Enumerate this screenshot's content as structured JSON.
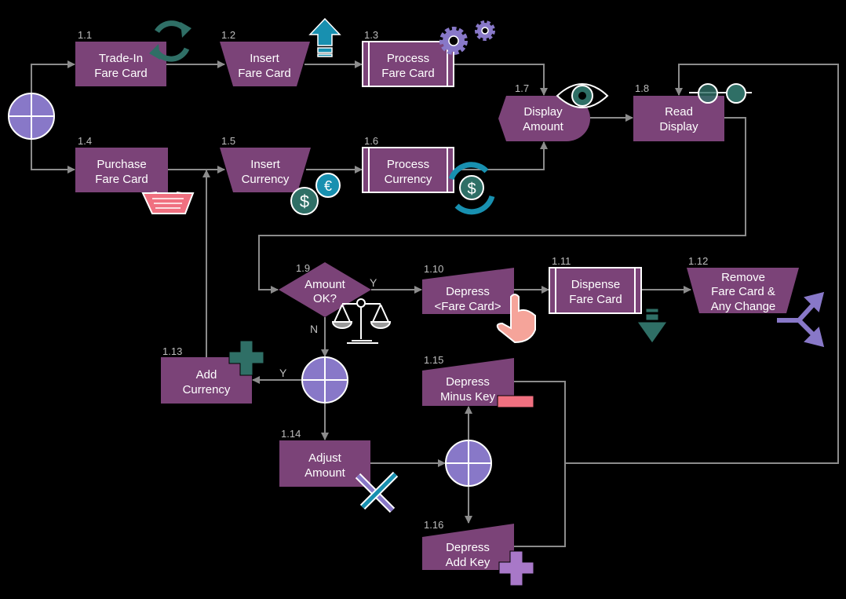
{
  "colors": {
    "node": "#7b4378",
    "gateway": "#8878c8",
    "connector": "#8c8c8c",
    "teal": "#2f6f66",
    "blue": "#1890b0",
    "pink": "#f07080"
  },
  "nodes": [
    {
      "id": "1.1",
      "label": [
        "Trade-In",
        "Fare Card"
      ],
      "icon": "refresh-icon"
    },
    {
      "id": "1.2",
      "label": [
        "Insert",
        "Fare Card"
      ],
      "icon": "upload-arrow-icon"
    },
    {
      "id": "1.3",
      "label": [
        "Process",
        "Fare Card"
      ],
      "icon": "gears-icon"
    },
    {
      "id": "1.4",
      "label": [
        "Purchase",
        "Fare Card"
      ],
      "icon": "shopping-basket-icon"
    },
    {
      "id": "1.5",
      "label": [
        "Insert",
        "Currency"
      ],
      "icon": "coins-icon"
    },
    {
      "id": "1.6",
      "label": [
        "Process",
        "Currency"
      ],
      "icon": "currency-exchange-icon"
    },
    {
      "id": "1.7",
      "label": [
        "Display",
        "Amount"
      ],
      "icon": "eye-icon"
    },
    {
      "id": "1.8",
      "label": [
        "Read",
        "Display"
      ],
      "icon": "glasses-icon"
    },
    {
      "id": "1.9",
      "label": [
        "Amount",
        "OK?"
      ],
      "icon": "scales-icon"
    },
    {
      "id": "1.10",
      "label": [
        "Depress",
        "<Fare Card>"
      ],
      "icon": "pointing-hand-icon"
    },
    {
      "id": "1.11",
      "label": [
        "Dispense",
        "Fare Card"
      ],
      "icon": "download-arrow-icon"
    },
    {
      "id": "1.12",
      "label": [
        "Remove",
        "Fare Card &",
        "Any Change"
      ],
      "icon": "split-arrow-icon"
    },
    {
      "id": "1.13",
      "label": [
        "Add",
        "Currency"
      ],
      "icon": "plus-icon"
    },
    {
      "id": "1.14",
      "label": [
        "Adjust",
        "Amount"
      ],
      "icon": "tools-icon"
    },
    {
      "id": "1.15",
      "label": [
        "Depress",
        "Minus Key"
      ],
      "icon": "minus-icon"
    },
    {
      "id": "1.16",
      "label": [
        "Depress",
        "Add Key"
      ],
      "icon": "plus-icon"
    }
  ],
  "edge_labels": {
    "yes1": "Y",
    "no1": "N",
    "yes2": "Y"
  }
}
